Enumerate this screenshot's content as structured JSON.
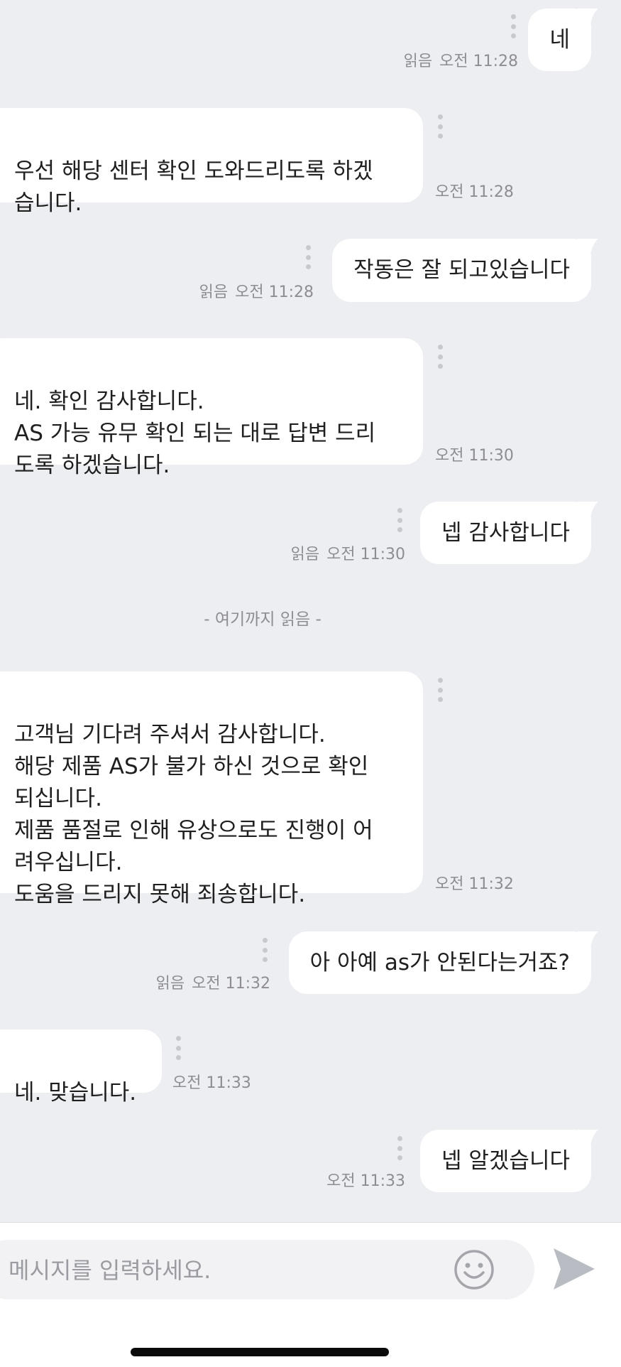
{
  "messages": [
    {
      "text": "네",
      "time": "오전 11:28",
      "read_label": "읽음"
    },
    {
      "text": "우선 해당 센터 확인 도와드리도록 하겠\n습니다.",
      "time": "오전 11:28"
    },
    {
      "text": "작동은 잘 되고있습니다",
      "time": "오전 11:28",
      "read_label": "읽음"
    },
    {
      "text": "네. 확인 감사합니다.\nAS 가능 유무 확인 되는 대로 답변 드리\n도록 하겠습니다.",
      "time": "오전 11:30"
    },
    {
      "text": "넵 감사합니다",
      "time": "오전 11:30",
      "read_label": "읽음"
    },
    {
      "text": "고객님 기다려 주셔서 감사합니다.\n해당 제품 AS가 불가 하신 것으로 확인\n되십니다.\n제품 품절로 인해 유상으로도 진행이 어\n려우십니다.\n도움을 드리지 못해 죄송합니다.",
      "time": "오전 11:32"
    },
    {
      "text": "아 아예 as가 안된다는거죠?",
      "time": "오전 11:32",
      "read_label": "읽음"
    },
    {
      "text": "네. 맞습니다.",
      "time": "오전 11:33"
    },
    {
      "text": "넵 알겠습니다",
      "time": "오전 11:33"
    }
  ],
  "divider": "- 여기까지 읽음 -",
  "composer": {
    "placeholder": "메시지를 입력하세요."
  },
  "icons": {
    "emoji": "smiley-icon",
    "send": "send-arrow-icon",
    "more": "more-vertical-icon"
  },
  "colors": {
    "background": "#edeef1",
    "bubble": "#ffffff",
    "meta_text": "#8d8d93"
  }
}
